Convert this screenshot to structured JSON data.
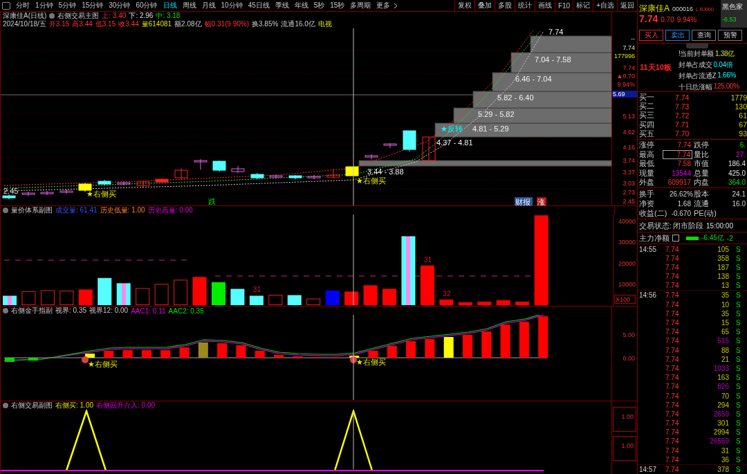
{
  "toolbar": {
    "periods": [
      {
        "label": "分时",
        "selected": false
      },
      {
        "label": "1分钟",
        "selected": false
      },
      {
        "label": "5分钟",
        "selected": false
      },
      {
        "label": "15分钟",
        "selected": false
      },
      {
        "label": "30分钟",
        "selected": false
      },
      {
        "label": "60分钟",
        "selected": false
      },
      {
        "label": "日线",
        "selected": true
      },
      {
        "label": "周线",
        "selected": false
      },
      {
        "label": "月线",
        "selected": false
      },
      {
        "label": "10分钟",
        "selected": false
      },
      {
        "label": "45日线",
        "selected": false
      },
      {
        "label": "季线",
        "selected": false
      },
      {
        "label": "年线",
        "selected": false
      },
      {
        "label": "5秒",
        "selected": false
      },
      {
        "label": "15秒",
        "selected": false
      },
      {
        "label": "多周期",
        "selected": false
      },
      {
        "label": "更多",
        "selected": false
      }
    ],
    "actions": [
      "复权",
      "叠加",
      "多股",
      "统计",
      "画线",
      "F10",
      "标记",
      "+自选",
      "返回"
    ]
  },
  "main_chart": {
    "title": "深康佳A(日线)",
    "indicator": "右侧交易主图",
    "params": [
      {
        "text": "上: 3.40",
        "kind": "up"
      },
      {
        "text": "下: 2.96",
        "kind": "flat"
      },
      {
        "text": "中: 3.18",
        "kind": "down"
      }
    ],
    "quote": [
      {
        "text": "2024/10/18/五",
        "kind": "gray"
      },
      {
        "text": "开3.15",
        "kind": "up"
      },
      {
        "text": "高3.44",
        "kind": "up"
      },
      {
        "text": "低3.15",
        "kind": "up"
      },
      {
        "text": "收3.44",
        "kind": "up"
      },
      {
        "text": "量614081",
        "kind": "yellow"
      },
      {
        "text": "额2.08亿",
        "kind": "gray"
      },
      {
        "text": "幅0.31(9.90%)",
        "kind": "up"
      },
      {
        "text": "换3.85%",
        "kind": "gray"
      },
      {
        "text": "流通16.0亿",
        "kind": "gray"
      },
      {
        "text": "电视",
        "kind": "yellow"
      }
    ],
    "labels": [
      {
        "text": "7.74",
        "kind": "zone"
      },
      {
        "text": "7.04 - 7.58",
        "kind": "zone"
      },
      {
        "text": "6.46 - 7.04",
        "kind": "zone"
      },
      {
        "text": "5.82 - 6.40",
        "kind": "zone"
      },
      {
        "text": "5.29 - 5.82",
        "kind": "zone"
      },
      {
        "text": "★反转",
        "kind": "reversal"
      },
      {
        "text": "4.81 - 5.29",
        "kind": "zone"
      },
      {
        "text": "4.37 - 4.81",
        "kind": "zone"
      },
      {
        "text": "3.44 - 3.88",
        "kind": "zone"
      },
      {
        "text": "★右侧买",
        "kind": "signal"
      },
      {
        "text": "2.45",
        "kind": "price"
      },
      {
        "text": "★右侧买",
        "kind": "signal"
      },
      {
        "text": "跌",
        "kind": "fall"
      },
      {
        "text": "财报",
        "kind": "report"
      },
      {
        "text": "涨",
        "kind": "rise"
      }
    ],
    "axis": [
      {
        "text": "--",
        "kind": "flat"
      },
      {
        "text": "7.74",
        "kind": "flat"
      },
      {
        "text": "177996",
        "kind": "yellow"
      },
      {
        "text": "7.74",
        "kind": "up"
      },
      {
        "text": "▲0.70",
        "kind": "up"
      },
      {
        "text": "9.94%",
        "kind": "up"
      },
      {
        "text": "5.69",
        "kind": "current"
      },
      {
        "text": "5.13",
        "kind": "up"
      },
      {
        "text": "4.62",
        "kind": "up"
      },
      {
        "text": "4.16",
        "kind": "up"
      },
      {
        "text": "3.74",
        "kind": "up"
      },
      {
        "text": "3.37",
        "kind": "up"
      },
      {
        "text": "3.03",
        "kind": "up"
      },
      {
        "text": "2.73",
        "kind": "up"
      },
      {
        "text": "2.45",
        "kind": "up"
      }
    ]
  },
  "volume_panel": {
    "title": "量价体系副图",
    "params": [
      {
        "text": "成交量: 61.41",
        "kind": "blue"
      },
      {
        "text": "历史低量: 1.00",
        "kind": "orange"
      },
      {
        "text": "历史高量: 0.00",
        "kind": "magenta"
      }
    ],
    "unit": "X100",
    "axis": [
      "40000",
      "30000",
      "20000",
      "10000"
    ],
    "annotations": [
      "31",
      "31",
      "32"
    ]
  },
  "finger_panel": {
    "title": "右侧金手指副",
    "params": [
      {
        "text": "视界: 0.35",
        "kind": "gray"
      },
      {
        "text": "视界12: 0.00",
        "kind": "gray"
      },
      {
        "text": "AAC1: 0.11",
        "kind": "magenta"
      },
      {
        "text": "AAC2: 0.35",
        "kind": "down"
      }
    ],
    "labels": [
      "★右侧买",
      "★右侧买"
    ],
    "axis": [
      "5.00",
      "0.00"
    ]
  },
  "trade_panel": {
    "title": "右侧交易副图",
    "params": [
      {
        "text": "右侧买: 1.00",
        "kind": "yellow"
      },
      {
        "text": "右侧回升介入: 0.00",
        "kind": "magenta"
      }
    ],
    "axis": [
      "1.00",
      "1.00"
    ]
  },
  "quote_panel": {
    "name": "深康佳A",
    "code": "000016",
    "tag": "L RJ000",
    "sector": "黑色家",
    "sector_change": "-6.53",
    "price": "7.74",
    "change": "0.70",
    "percent": "9.94%",
    "buttons": [
      {
        "label": "买入",
        "kind": "buy"
      },
      {
        "label": "卖出",
        "kind": "sell"
      },
      {
        "label": "查询",
        "kind": "plain"
      },
      {
        "label": "预警",
        "kind": "plain"
      }
    ],
    "streak": "11天10板",
    "limit_info": [
      {
        "label": "!当前封单额",
        "value": "1.38亿",
        "kind": "yellow"
      },
      {
        "label": "封单占成交",
        "value": "0.04倍",
        "kind": "cyan"
      },
      {
        "label": "封单占流通Z",
        "value": "1.66%",
        "kind": "cyan"
      },
      {
        "label": "十日总涨幅",
        "value": "125.00%",
        "kind": "up"
      }
    ],
    "order_book": [
      {
        "label": "买一",
        "price": "7.74",
        "volume": "1779"
      },
      {
        "label": "买二",
        "price": "7.73",
        "volume": "130"
      },
      {
        "label": "买三",
        "price": "7.72",
        "volume": "61"
      },
      {
        "label": "买四",
        "price": "7.71",
        "volume": "67"
      },
      {
        "label": "买五",
        "price": "7.70",
        "volume": "93"
      }
    ],
    "stats": [
      [
        {
          "label": "涨停",
          "value": "7.74",
          "kind": "up",
          "highlighted": false
        },
        {
          "label": "跌停",
          "value": "6.",
          "kind": "down",
          "highlighted": false
        }
      ],
      [
        {
          "label": "最高",
          "value": "7.74",
          "kind": "up",
          "highlighted": true
        },
        {
          "label": "量比",
          "value": "27.",
          "kind": "magenta",
          "highlighted": false
        }
      ],
      [
        {
          "label": "最低",
          "value": "7.58",
          "kind": "up",
          "highlighted": false
        },
        {
          "label": "市值",
          "value": "186.4",
          "kind": "flat",
          "highlighted": false
        }
      ],
      [
        {
          "label": "现量",
          "value": "13544",
          "kind": "magenta",
          "highlighted": false
        },
        {
          "label": "总量",
          "value": "425.0",
          "kind": "flat",
          "highlighted": false
        }
      ],
      [
        {
          "label": "外盘",
          "value": "609917",
          "kind": "up",
          "highlighted": false
        },
        {
          "label": "内盘",
          "value": "364.0",
          "kind": "down",
          "highlighted": false
        }
      ]
    ],
    "stats2": [
      [
        {
          "label": "换手",
          "value": "26.62%"
        },
        {
          "label": "股本",
          "value": "24.1"
        }
      ],
      [
        {
          "label": "净资",
          "value": "1.68"
        },
        {
          "label": "流通",
          "value": "16.0"
        }
      ],
      [
        {
          "label": "收益(二)",
          "value": "-0.670"
        },
        {
          "label": "PE(动)"
        }
      ]
    ],
    "status_label": "交易状态:",
    "status": "闭市阶段",
    "status_time": "15:00:00",
    "flow_label": "主力净额",
    "flow_value": "-6.45亿",
    "flow_extra": "-2",
    "ticks": [
      {
        "time": "14:55",
        "trades": [
          {
            "price": "7.74",
            "volume": "105",
            "large": false,
            "side": "S"
          },
          {
            "price": "7.74",
            "volume": "358",
            "large": false,
            "side": "S"
          },
          {
            "price": "7.74",
            "volume": "187",
            "large": false,
            "side": "S"
          },
          {
            "price": "7.74",
            "volume": "138",
            "large": false,
            "side": "S"
          },
          {
            "price": "7.74",
            "volume": "13",
            "large": false,
            "side": "S"
          }
        ]
      },
      {
        "time": "14:56",
        "trades": [
          {
            "price": "7.74",
            "volume": "35",
            "large": false,
            "side": "S"
          },
          {
            "price": "7.74",
            "volume": "10",
            "large": false,
            "side": "S"
          },
          {
            "price": "7.74",
            "volume": "35",
            "large": false,
            "side": "S"
          },
          {
            "price": "7.74",
            "volume": "15",
            "large": false,
            "side": "S"
          },
          {
            "price": "7.74",
            "volume": "65",
            "large": false,
            "side": "S"
          },
          {
            "price": "7.74",
            "volume": "515",
            "large": true,
            "side": "S"
          },
          {
            "price": "7.74",
            "volume": "88",
            "large": false,
            "side": "S"
          },
          {
            "price": "7.74",
            "volume": "21",
            "large": false,
            "side": "S"
          },
          {
            "price": "7.74",
            "volume": "1033",
            "large": true,
            "side": "S"
          },
          {
            "price": "7.74",
            "volume": "163",
            "large": false,
            "side": "S"
          },
          {
            "price": "7.74",
            "volume": "826",
            "large": true,
            "side": "S"
          },
          {
            "price": "7.74",
            "volume": "70",
            "large": false,
            "side": "S"
          },
          {
            "price": "7.74",
            "volume": "294",
            "large": false,
            "side": "S"
          },
          {
            "price": "7.74",
            "volume": "2659",
            "large": true,
            "side": "S"
          },
          {
            "price": "7.74",
            "volume": "301",
            "large": false,
            "side": "S"
          },
          {
            "price": "7.74",
            "volume": "2994",
            "large": false,
            "side": "S"
          },
          {
            "price": "7.74",
            "volume": "26559",
            "large": true,
            "side": "S"
          },
          {
            "price": "7.74",
            "volume": "31",
            "large": false,
            "side": "S"
          },
          {
            "price": "7.74",
            "volume": "36",
            "large": false,
            "side": "S"
          }
        ]
      },
      {
        "time": "14:57",
        "trades": [
          {
            "price": "7.74",
            "volume": "378",
            "large": false,
            "side": "S"
          }
        ]
      }
    ]
  }
}
